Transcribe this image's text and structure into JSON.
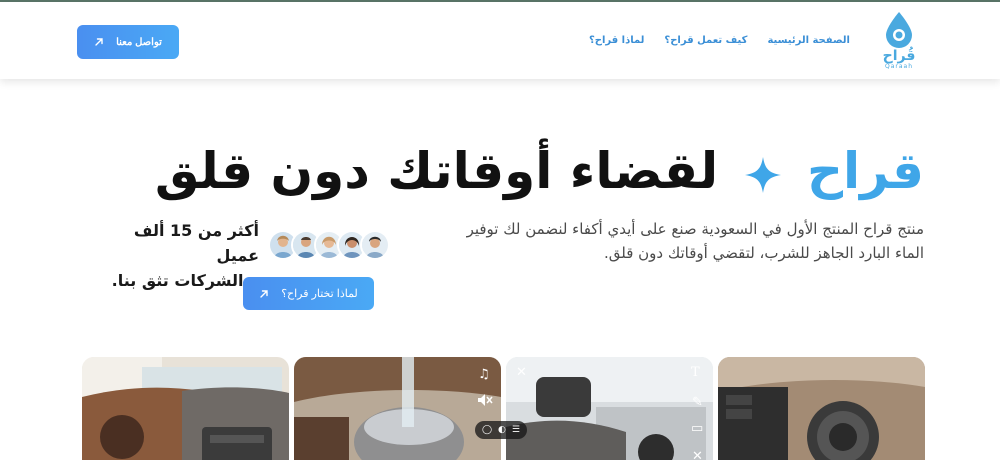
{
  "header": {
    "logo_word": "قُراح",
    "logo_sub": "Qaraah",
    "nav": [
      {
        "label": "الصفحة الرئيسية"
      },
      {
        "label": "كيف تعمل قراح؟"
      },
      {
        "label": "لماذا قراح؟"
      }
    ],
    "contact_label": "تواصل معنا"
  },
  "hero": {
    "title_brand": "قراح",
    "title_rest": "لقضاء أوقاتك دون قلق",
    "description": "منتج قراح المنتج الأول في السعودية صنع على أيدي أكفاء لنضمن لك توفير الماء البارد الجاهز للشرب، لتقضي أوقاتك دون قلق.",
    "customers_line1": "أكثر من 15 ألف عميل",
    "customers_line2": "و الشركات تثق بنا.",
    "why_label": "لماذا تختار قراح؟"
  },
  "colors": {
    "accent": "#3fa6e8",
    "button_start": "#4a8ff0",
    "button_end": "#4aa9f5"
  },
  "icons": [
    "arrow-up-right-icon",
    "sparkle-icon",
    "music-note-icon",
    "mute-icon",
    "text-icon",
    "pencil-icon",
    "sticker-icon",
    "close-icon",
    "chat-icon",
    "menu-icon"
  ]
}
